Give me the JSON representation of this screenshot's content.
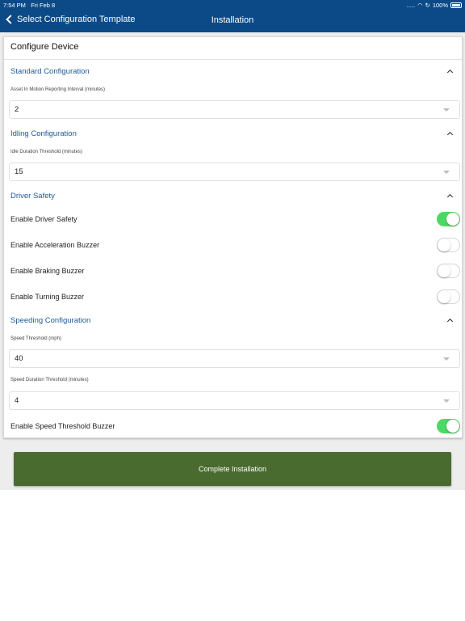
{
  "status": {
    "time": "7:54 PM",
    "date": "Fri Feb 8",
    "dots": ".....",
    "battery": "100%"
  },
  "nav": {
    "back_label": "Select Configuration Template",
    "title": "Installation"
  },
  "card": {
    "title": "Configure Device"
  },
  "standard": {
    "title": "Standard Configuration",
    "field_label": "Asset In Motion Reporting Interval (minutes)",
    "value": "2"
  },
  "idling": {
    "title": "Idling Configuration",
    "field_label": "Idle Duration Threshold (minutes)",
    "value": "15"
  },
  "driver": {
    "title": "Driver Safety",
    "toggles": [
      {
        "label": "Enable Driver Safety",
        "on": true
      },
      {
        "label": "Enable Acceleration Buzzer",
        "on": false
      },
      {
        "label": "Enable Braking Buzzer",
        "on": false
      },
      {
        "label": "Enable Turning Buzzer",
        "on": false
      }
    ]
  },
  "speeding": {
    "title": "Speeding Configuration",
    "speed_label": "Speed Threshold (mph)",
    "speed_value": "40",
    "duration_label": "Speed Duration Threshold (minutes)",
    "duration_value": "4",
    "buzzer_label": "Enable Speed Threshold Buzzer",
    "buzzer_on": true
  },
  "actions": {
    "complete_label": "Complete Installation"
  },
  "colors": {
    "nav": "#0b4a86",
    "section": "#1b5a96",
    "toggle_on": "#4bd864",
    "button": "#4a6b30"
  }
}
